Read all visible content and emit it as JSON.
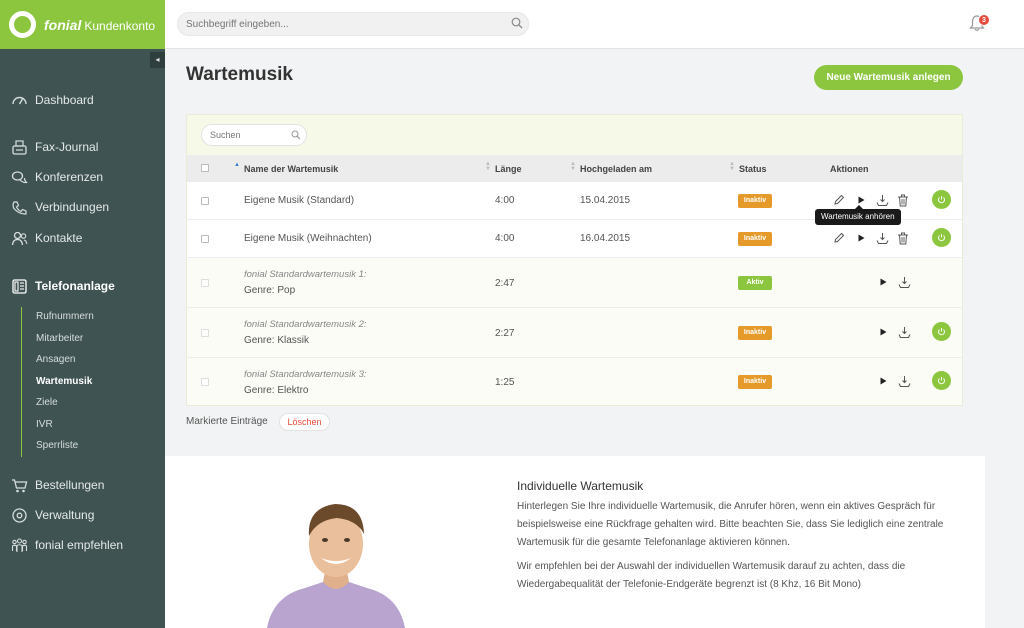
{
  "app": {
    "brand": "fonial",
    "subtitle": "Kundenkonto"
  },
  "topbar": {
    "search_placeholder": "Suchbegriff eingeben...",
    "notification_count": "3"
  },
  "sidebar": {
    "collapse_symbol": "◂",
    "items": [
      {
        "label": "Dashboard",
        "icon": "speedometer-icon"
      },
      {
        "label": "Fax-Journal",
        "icon": "fax-icon"
      },
      {
        "label": "Konferenzen",
        "icon": "conference-icon"
      },
      {
        "label": "Verbindungen",
        "icon": "phone-icon"
      },
      {
        "label": "Kontakte",
        "icon": "contacts-icon"
      },
      {
        "label": "Telefonanlage",
        "icon": "phone-system-icon",
        "active": true
      },
      {
        "label": "Bestellungen",
        "icon": "cart-icon"
      },
      {
        "label": "Verwaltung",
        "icon": "gear-icon"
      },
      {
        "label": "fonial empfehlen",
        "icon": "people-icon"
      }
    ],
    "subitems": [
      "Rufnummern",
      "Mitarbeiter",
      "Ansagen",
      "Wartemusik",
      "Ziele",
      "IVR",
      "Sperrliste"
    ],
    "active_subitem": "Wartemusik"
  },
  "page": {
    "title": "Wartemusik",
    "new_button": "Neue Wartemusik anlegen"
  },
  "table": {
    "filter_placeholder": "Suchen",
    "headers": {
      "name": "Name der Wartemusik",
      "length": "Länge",
      "uploaded": "Hochgeladen am",
      "status": "Status",
      "actions": "Aktionen"
    },
    "rows": [
      {
        "name": "Eigene Musik (Standard)",
        "length": "4:00",
        "uploaded": "15.04.2015",
        "status": "Inaktiv"
      },
      {
        "name": "Eigene Musik (Weihnachten)",
        "length": "4:00",
        "uploaded": "16.04.2015",
        "status": "Inaktiv"
      },
      {
        "line1": "fonial Standardwartemusik 1:",
        "line2": "Genre: Pop",
        "length": "2:47",
        "status": "Aktiv"
      },
      {
        "line1": "fonial Standardwartemusik 2:",
        "line2": "Genre: Klassik",
        "length": "2:27",
        "status": "Inaktiv"
      },
      {
        "line1": "fonial Standardwartemusik 3:",
        "line2": "Genre: Elektro",
        "length": "1:25",
        "status": "Inaktiv"
      }
    ],
    "tooltip": "Wartemusik anhören"
  },
  "bulk": {
    "label": "Markierte Einträge",
    "delete": "Löschen"
  },
  "info": {
    "title": "Individuelle Wartemusik",
    "p1_l1": "Hinterlegen Sie Ihre individuelle Wartemusik, die Anrufer hören, wenn ein aktives Gespräch für",
    "p1_l2": "beispielsweise eine Rückfrage gehalten wird. Bitte beachten Sie, dass Sie lediglich eine zentrale",
    "p1_l3": "Wartemusik für die gesamte Telefonanlage aktivieren können.",
    "p2_l1": "Wir empfehlen bei der Auswahl der individuellen Wartemusik darauf zu achten, dass die",
    "p2_l2": "Wiedergabequalität der Telefonie-Endgeräte begrenzt ist (8 Khz, 16 Bit Mono)"
  },
  "colors": {
    "brand_green": "#8cc63f",
    "sidebar_bg": "#3f5352",
    "inactive_orange": "#e69a29",
    "delete_red": "#e74c3c"
  }
}
